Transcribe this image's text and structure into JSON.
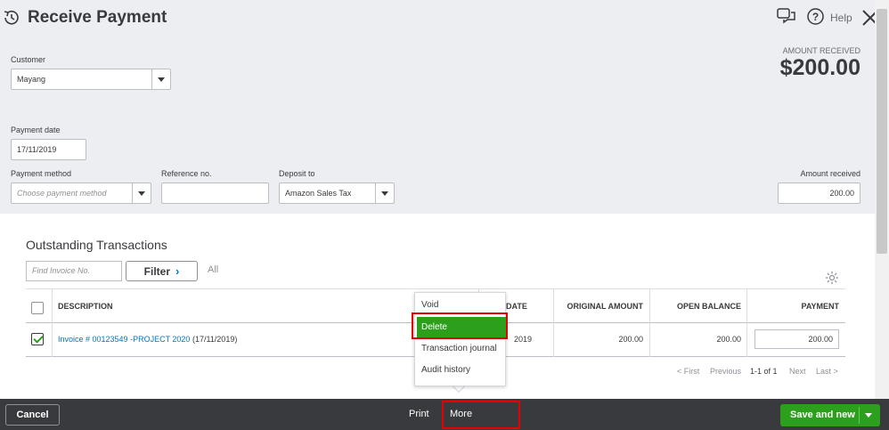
{
  "header": {
    "title": "Receive Payment",
    "help_label": "Help"
  },
  "form": {
    "customer_label": "Customer",
    "customer_value": "Mayang",
    "payment_date_label": "Payment date",
    "payment_date_value": "17/11/2019",
    "payment_method_label": "Payment method",
    "payment_method_placeholder": "Choose payment method",
    "reference_label": "Reference no.",
    "reference_value": "",
    "deposit_label": "Deposit to",
    "deposit_value": "Amazon Sales Tax",
    "amount_received_label": "Amount received",
    "amount_received_value": "200.00"
  },
  "amount_summary": {
    "label": "AMOUNT RECEIVED",
    "value": "$200.00"
  },
  "transactions": {
    "title": "Outstanding Transactions",
    "find_placeholder": "Find Invoice No.",
    "filter_label": "Filter",
    "all_label": "All",
    "columns": [
      "DESCRIPTION",
      "DATE",
      "ORIGINAL AMOUNT",
      "OPEN BALANCE",
      "PAYMENT"
    ],
    "rows": [
      {
        "checked": true,
        "description_link": "Invoice # 00123549 -PROJECT 2020",
        "description_date": "(17/11/2019)",
        "due_date_partial": "2019",
        "original_amount": "200.00",
        "open_balance": "200.00",
        "payment": "200.00"
      }
    ],
    "pager": {
      "first": "< First",
      "previous": "Previous",
      "range": "1-1 of 1",
      "next": "Next",
      "last": "Last >"
    }
  },
  "more_menu": {
    "items": [
      "Void",
      "Delete",
      "Transaction journal",
      "Audit history"
    ],
    "active_index": 1
  },
  "footer": {
    "cancel_label": "Cancel",
    "print_label": "Print",
    "more_label": "More",
    "save_label": "Save and new"
  },
  "colors": {
    "accent_green": "#2ca01c",
    "link_blue": "#0077c5",
    "highlight_red": "#e60000",
    "footer_bg": "#393a3d"
  }
}
